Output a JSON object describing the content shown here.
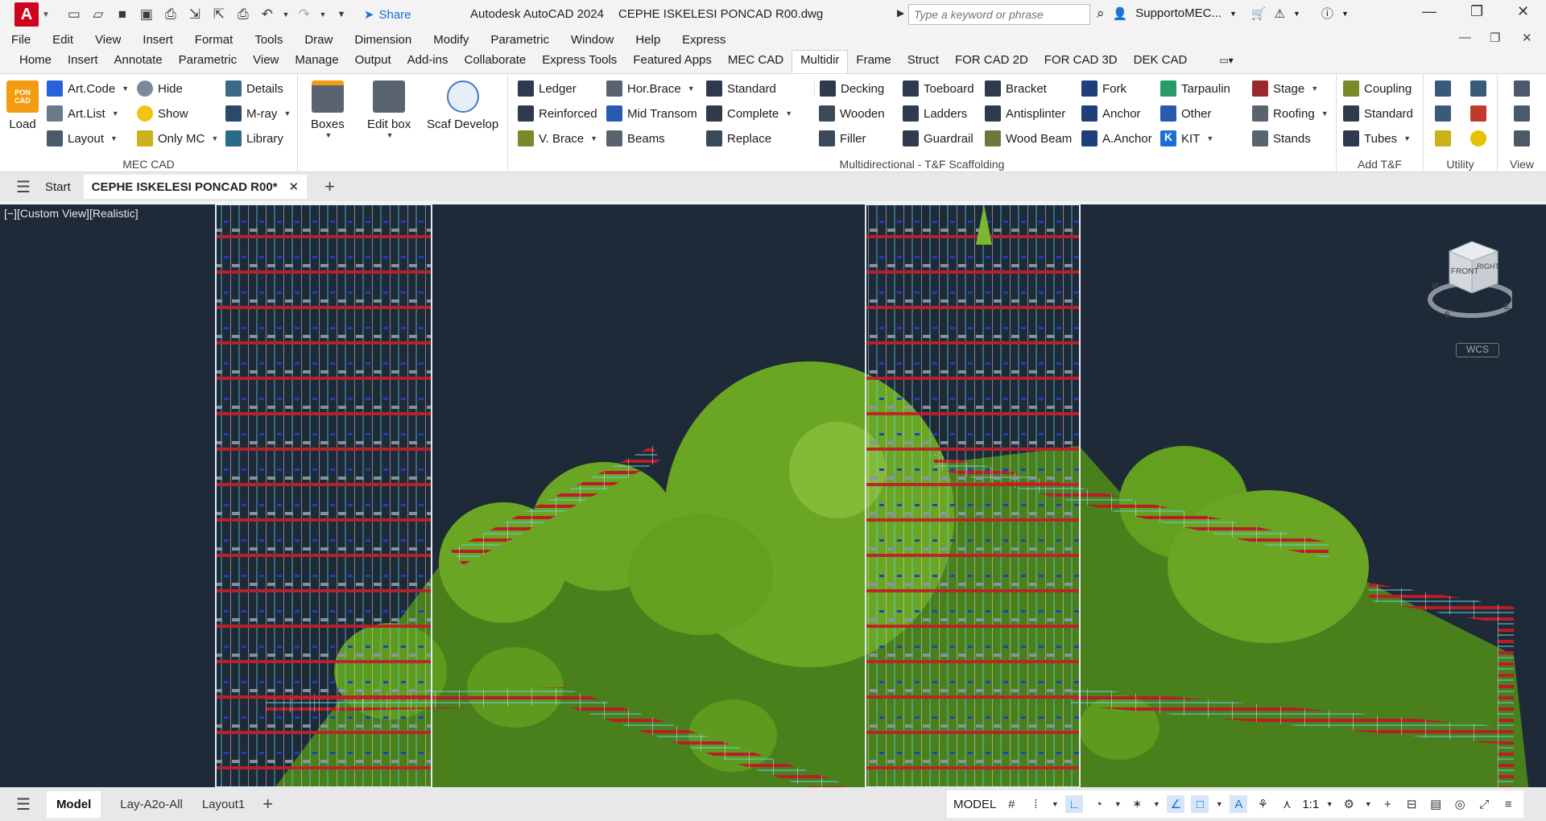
{
  "app": {
    "icon_letter": "A",
    "name": "Autodesk AutoCAD 2024",
    "file": "CEPHE ISKELESI PONCAD R00.dwg"
  },
  "qat": {
    "share_label": "Share"
  },
  "search": {
    "placeholder": "Type a keyword or phrase"
  },
  "user": {
    "name": "SupportoMEC..."
  },
  "menu": [
    "File",
    "Edit",
    "View",
    "Insert",
    "Format",
    "Tools",
    "Draw",
    "Dimension",
    "Modify",
    "Parametric",
    "Window",
    "Help",
    "Express"
  ],
  "ribbon_tabs": [
    "Home",
    "Insert",
    "Annotate",
    "Parametric",
    "View",
    "Manage",
    "Output",
    "Add-ins",
    "Collaborate",
    "Express Tools",
    "Featured Apps",
    "MEC CAD",
    "Multidir",
    "Frame",
    "Struct",
    "FOR CAD 2D",
    "FOR CAD 3D",
    "DEK CAD"
  ],
  "active_tab": "Multidir",
  "ribbon": {
    "load": {
      "label": "Load",
      "logo_text": "PON CAD"
    },
    "mec": {
      "artcode": "Art.Code",
      "artlist": "Art.List",
      "layout": "Layout",
      "hide": "Hide",
      "show": "Show",
      "onlymc": "Only MC",
      "details": "Details",
      "mray": "M-ray",
      "library": "Library",
      "panel_label": "MEC CAD"
    },
    "big": {
      "boxes": "Boxes",
      "editbox": "Edit box",
      "scaf": "Scaf Develop"
    },
    "multi": {
      "ledger": "Ledger",
      "reinforced": "Reinforced",
      "vbrace": "V. Brace",
      "horbrace": "Hor.Brace",
      "midtransom": "Mid Transom",
      "beams": "Beams",
      "standard": "Standard",
      "complete": "Complete",
      "replace": "Replace",
      "decking": "Decking",
      "wooden": "Wooden",
      "filler": "Filler",
      "toeboard": "Toeboard",
      "ladders": "Ladders",
      "guardrail": "Guardrail",
      "bracket": "Bracket",
      "antisplinter": "Antisplinter",
      "woodbeam": "Wood Beam",
      "fork": "Fork",
      "anchor": "Anchor",
      "aanchor": "A.Anchor",
      "tarpaulin": "Tarpaulin",
      "other": "Other",
      "kit": "KIT",
      "stage": "Stage",
      "roofing": "Roofing",
      "stands": "Stands",
      "panel_label": "Multidirectional - T&F Scaffolding"
    },
    "addtf": {
      "coupling": "Coupling",
      "standard": "Standard",
      "tubes": "Tubes",
      "panel_label": "Add T&F"
    },
    "utility_label": "Utility",
    "view_label": "View"
  },
  "doctabs": {
    "start": "Start",
    "active": "CEPHE ISKELESI PONCAD R00*"
  },
  "viewport": {
    "label": "[−][Custom View][Realistic]",
    "cube_front": "FRONT",
    "cube_right": "RIGHT",
    "compass_w": "W",
    "compass_s": "S",
    "compass_e": "E",
    "wcs": "WCS"
  },
  "layouts": [
    "Model",
    "Lay-A2o-All",
    "Layout1"
  ],
  "status": {
    "model": "MODEL",
    "scale": "1:1"
  }
}
